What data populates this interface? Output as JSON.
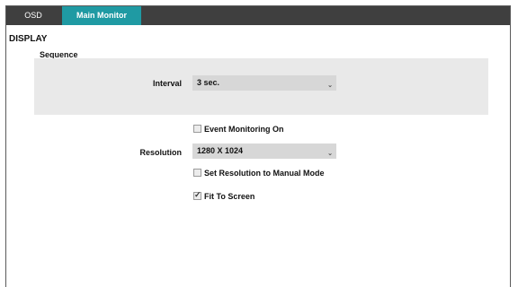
{
  "tabs": [
    {
      "label": "OSD"
    },
    {
      "label": "Main Monitor"
    }
  ],
  "section": {
    "title": "DISPLAY"
  },
  "sequence": {
    "title": "Sequence",
    "interval_label": "Interval",
    "interval_value": "3 sec."
  },
  "event_monitoring": {
    "label": "Event Monitoring On",
    "checked": false
  },
  "resolution": {
    "label": "Resolution",
    "value": "1280 X 1024"
  },
  "manual_mode": {
    "label": "Set Resolution to Manual Mode",
    "checked": false
  },
  "fit_to_screen": {
    "label": "Fit To Screen",
    "checked": true
  },
  "colors": {
    "tab_active": "#1f9aa3",
    "tabbar": "#3f3f3f",
    "panel": "#e9e9e9"
  },
  "icons": {
    "dropdown": "chevron-down-icon",
    "check": "checkmark-icon"
  }
}
